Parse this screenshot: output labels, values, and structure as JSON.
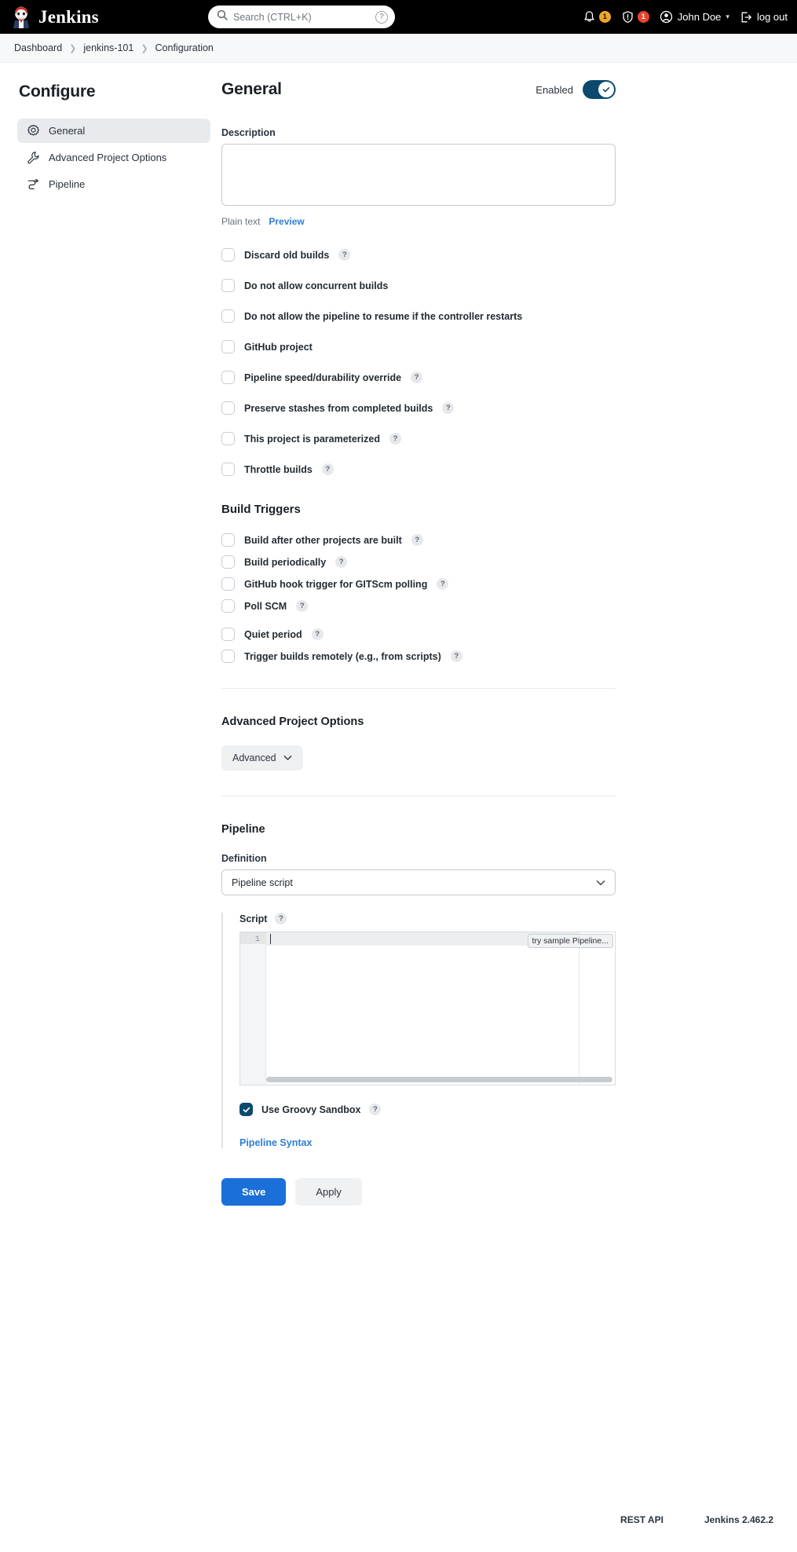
{
  "header": {
    "brand": "Jenkins",
    "search_placeholder": "Search (CTRL+K)",
    "search_value": "",
    "help_hint": "?",
    "notifications_count": "1",
    "security_count": "1",
    "user_name": "John Doe",
    "logout_label": "log out"
  },
  "breadcrumbs": [
    {
      "label": "Dashboard"
    },
    {
      "label": "jenkins-101"
    },
    {
      "label": "Configuration"
    }
  ],
  "sidebar": {
    "title": "Configure",
    "items": [
      {
        "label": "General",
        "icon": "gear-icon",
        "active": true
      },
      {
        "label": "Advanced Project Options",
        "icon": "wrench-icon",
        "active": false
      },
      {
        "label": "Pipeline",
        "icon": "pipeline-icon",
        "active": false
      }
    ]
  },
  "general": {
    "title": "General",
    "enabled_label": "Enabled",
    "enabled": true,
    "description_label": "Description",
    "description_value": "",
    "plain_text_label": "Plain text",
    "preview_label": "Preview",
    "checkboxes": [
      {
        "label": "Discard old builds",
        "help": "?",
        "checked": false
      },
      {
        "label": "Do not allow concurrent builds",
        "help": "",
        "checked": false
      },
      {
        "label": "Do not allow the pipeline to resume if the controller restarts",
        "help": "",
        "checked": false
      },
      {
        "label": "GitHub project",
        "help": "",
        "checked": false
      },
      {
        "label": "Pipeline speed/durability override",
        "help": "?",
        "checked": false
      },
      {
        "label": "Preserve stashes from completed builds",
        "help": "?",
        "checked": false
      },
      {
        "label": "This project is parameterized",
        "help": "?",
        "checked": false
      },
      {
        "label": "Throttle builds",
        "help": "?",
        "checked": false
      }
    ]
  },
  "build_triggers": {
    "title": "Build Triggers",
    "checkboxes": [
      {
        "label": "Build after other projects are built",
        "help": "?",
        "checked": false
      },
      {
        "label": "Build periodically",
        "help": "?",
        "checked": false
      },
      {
        "label": "GitHub hook trigger for GITScm polling",
        "help": "?",
        "checked": false
      },
      {
        "label": "Poll SCM",
        "help": "?",
        "checked": false
      },
      {
        "label": "Quiet period",
        "help": "?",
        "checked": false
      },
      {
        "label": "Trigger builds remotely (e.g., from scripts)",
        "help": "?",
        "checked": false
      }
    ]
  },
  "advanced_project_options": {
    "title": "Advanced Project Options",
    "advanced_button": "Advanced"
  },
  "pipeline": {
    "title": "Pipeline",
    "definition_label": "Definition",
    "definition_value": "Pipeline script",
    "script_label": "Script",
    "script_help": "?",
    "script_value": "",
    "line_number": "1",
    "sample_button": "try sample Pipeline...",
    "sandbox_label": "Use Groovy Sandbox",
    "sandbox_help": "?",
    "sandbox_checked": true,
    "pipeline_syntax_link": "Pipeline Syntax"
  },
  "actions": {
    "save_label": "Save",
    "apply_label": "Apply"
  },
  "footer": {
    "rest_api": "REST API",
    "version": "Jenkins 2.462.2"
  }
}
